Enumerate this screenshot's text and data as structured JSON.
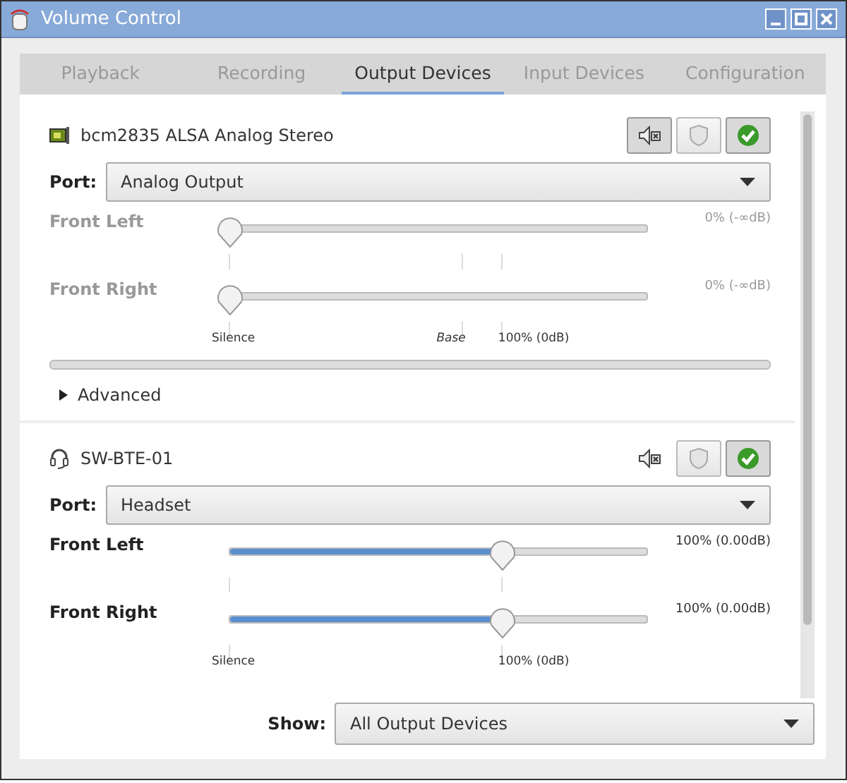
{
  "window": {
    "title": "Volume Control"
  },
  "tabs": [
    {
      "label": "Playback",
      "selected": false
    },
    {
      "label": "Recording",
      "selected": false
    },
    {
      "label": "Output Devices",
      "selected": true
    },
    {
      "label": "Input Devices",
      "selected": false
    },
    {
      "label": "Configuration",
      "selected": false
    }
  ],
  "devices": [
    {
      "kind": "card",
      "name": "bcm2835 ALSA Analog Stereo",
      "muted": true,
      "locked": false,
      "default": true,
      "port_label": "Port:",
      "port": "Analog Output",
      "channels": [
        {
          "name": "Front Left",
          "level": 0,
          "reading": "0% (-∞dB)"
        },
        {
          "name": "Front Right",
          "level": 0,
          "reading": "0% (-∞dB)"
        }
      ],
      "marks": [
        {
          "kind": "silence",
          "label": "Silence"
        },
        {
          "kind": "base",
          "label": "Base"
        },
        {
          "kind": "norm",
          "label": "100% (0dB)"
        }
      ],
      "meter": {
        "level": 0
      },
      "advanced": {
        "label": "Advanced",
        "expanded": false
      }
    },
    {
      "kind": "headset",
      "name": "SW-BTE-01",
      "muted": false,
      "locked": false,
      "default": true,
      "port_label": "Port:",
      "port": "Headset",
      "channels": [
        {
          "name": "Front Left",
          "level": 0.654,
          "reading": "100% (0.00dB)"
        },
        {
          "name": "Front Right",
          "level": 0.654,
          "reading": "100% (0.00dB)"
        }
      ],
      "marks": [
        {
          "kind": "silence",
          "label": "Silence"
        },
        {
          "kind": "norm",
          "label": "100% (0dB)"
        }
      ]
    }
  ],
  "show": {
    "label": "Show:",
    "value": "All Output Devices"
  }
}
